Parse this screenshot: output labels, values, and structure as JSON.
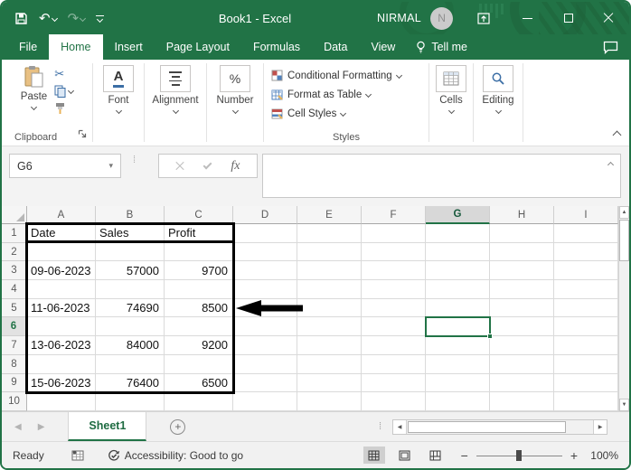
{
  "colors": {
    "accent_green": "#217346",
    "deco_green": "#1d6239",
    "selection_border": "#217346",
    "table_border": "#000000",
    "annotation_arrow": "#000000",
    "ribbon_bg": "#ffffff",
    "statusbar_bg": "#f1f1f1"
  },
  "icons": {
    "undo": "↶",
    "redo": "↷",
    "scissors": "✂",
    "name_box_caret": "▾",
    "up_arrow": "▲",
    "down_arrow": "▼",
    "left_arrow": "◀",
    "right_arrow": "▶",
    "dots": "⁞",
    "plus": "+"
  },
  "title_bar": {
    "title": "Book1 - Excel",
    "user": "NIRMAL",
    "avatar_initial": "N"
  },
  "ribbon_tabs": [
    {
      "label": "File"
    },
    {
      "label": "Home",
      "active": true
    },
    {
      "label": "Insert"
    },
    {
      "label": "Page Layout"
    },
    {
      "label": "Formulas"
    },
    {
      "label": "Data"
    },
    {
      "label": "View"
    }
  ],
  "tell_me": {
    "label": "Tell me"
  },
  "ribbon": {
    "paste": {
      "label": "Paste"
    },
    "clipboard_label": "Clipboard",
    "font": {
      "label": "Font",
      "glyph": "A"
    },
    "alignment": {
      "label": "Alignment"
    },
    "number": {
      "label": "Number",
      "glyph": "%"
    },
    "styles": {
      "label": "Styles",
      "items": [
        {
          "label": "Conditional Formatting"
        },
        {
          "label": "Format as Table"
        },
        {
          "label": "Cell Styles"
        }
      ]
    },
    "cells": {
      "label": "Cells"
    },
    "editing": {
      "label": "Editing"
    }
  },
  "formula_bar": {
    "name_box": "G6",
    "fx": "fx",
    "value": ""
  },
  "grid": {
    "columns": [
      "A",
      "B",
      "C",
      "D",
      "E",
      "F",
      "G",
      "H",
      "I"
    ],
    "row_count": 10,
    "selected_cell": "G6",
    "selected_column": "G",
    "selected_row": 6,
    "cells": {
      "1": {
        "A": "Date",
        "B": "Sales",
        "C": "Profit"
      },
      "3": {
        "A": "09-06-2023",
        "B": "57000",
        "C": "9700"
      },
      "5": {
        "A": "11-06-2023",
        "B": "74690",
        "C": "8500"
      },
      "7": {
        "A": "13-06-2023",
        "B": "84000",
        "C": "9200"
      },
      "9": {
        "A": "15-06-2023",
        "B": "76400",
        "C": "6500"
      }
    }
  },
  "sheet_bar": {
    "active_tab": "Sheet1"
  },
  "status_bar": {
    "mode": "Ready",
    "accessibility": "Accessibility: Good to go",
    "zoom_level": "100%"
  }
}
